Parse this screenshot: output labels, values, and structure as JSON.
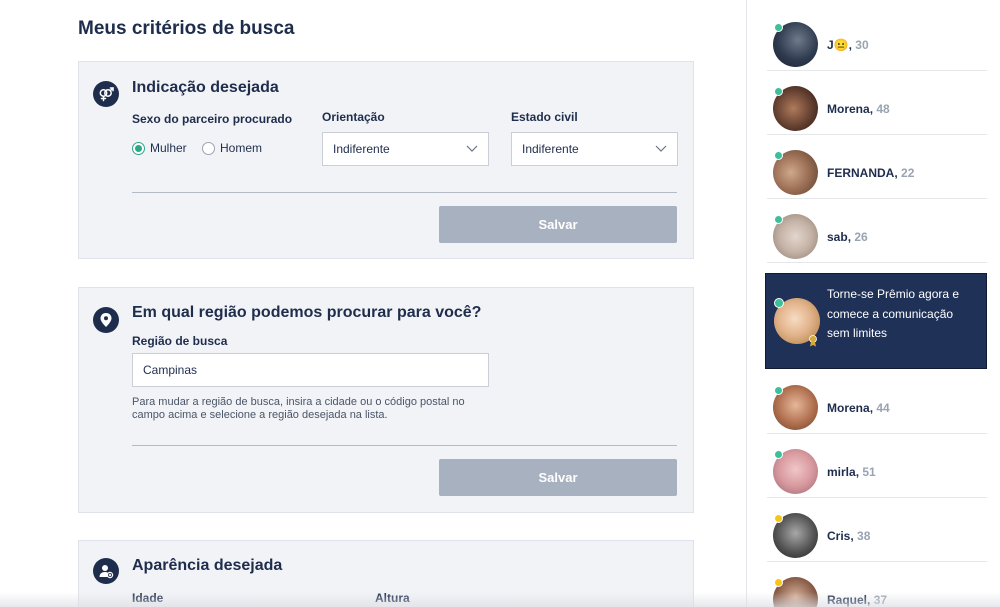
{
  "page": {
    "title": "Meus critérios de busca"
  },
  "cards": {
    "indicacao": {
      "title": "Indicação desejada",
      "sexo_label": "Sexo do parceiro procurado",
      "opt_mulher": "Mulher",
      "opt_homem": "Homem",
      "selected_sexo": "Mulher",
      "orientacao_label": "Orientação",
      "orientacao_value": "Indiferente",
      "estado_label": "Estado civil",
      "estado_value": "Indiferente",
      "save_label": "Salvar"
    },
    "regiao": {
      "title": "Em qual região podemos procurar para você?",
      "field_label": "Região de busca",
      "field_value": "Campinas",
      "hint": "Para mudar a região de busca, insira a cidade ou o código postal no campo acima e selecione a região desejada na lista.",
      "save_label": "Salvar"
    },
    "aparencia": {
      "title": "Aparência desejada",
      "idade_label": "Idade",
      "altura_label": "Altura"
    }
  },
  "sidebar": {
    "members": [
      {
        "name": "J😐",
        "age": "30",
        "status": "online",
        "status_color": "#3dbf9b"
      },
      {
        "name": "Morena",
        "age": "48",
        "status": "online",
        "status_color": "#3dbf9b"
      },
      {
        "name": "FERNANDA",
        "age": "22",
        "status": "online",
        "status_color": "#3dbf9b"
      },
      {
        "name": "sab",
        "age": "26",
        "status": "online",
        "status_color": "#3dbf9b"
      },
      {
        "name": "Morena",
        "age": "44",
        "status": "online",
        "status_color": "#3dbf9b"
      },
      {
        "name": "mirla",
        "age": "51",
        "status": "online",
        "status_color": "#3dbf9b"
      },
      {
        "name": "Cris",
        "age": "38",
        "status": "away",
        "status_color": "#f5c518"
      },
      {
        "name": "Raquel",
        "age": "37",
        "status": "away",
        "status_color": "#f5c518"
      }
    ],
    "promo": {
      "text": "Torne-se Prêmio agora e comece a comunicação sem limites"
    }
  },
  "colors": {
    "navy": "#1f2d4d",
    "promo_bg": "#1f3157",
    "accent_green": "#2fa58a",
    "button_disabled": "#a7b1bf",
    "card_bg": "#f2f3f6"
  },
  "icons": {
    "indicacao": "gender-symbols-icon",
    "regiao": "location-pin-icon",
    "aparencia": "user-profile-icon",
    "select": "chevron-down-icon"
  }
}
